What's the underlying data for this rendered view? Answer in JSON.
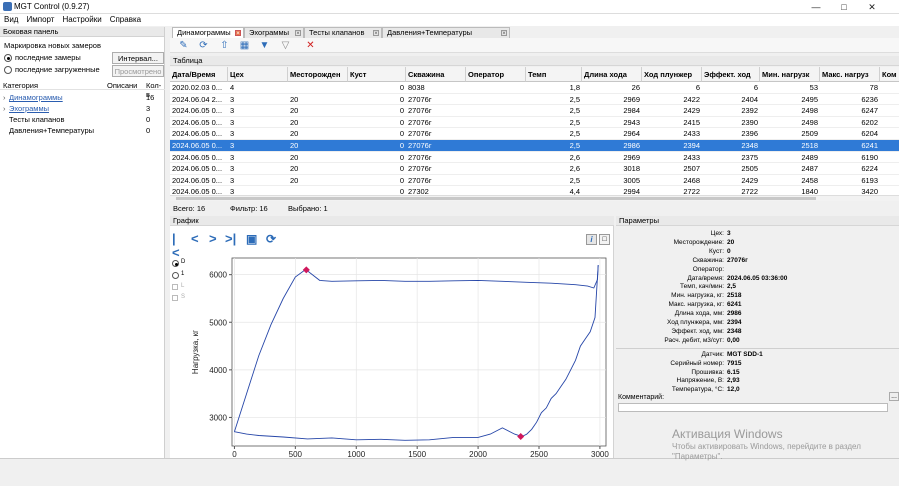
{
  "window": {
    "title": "MGT Control (0.9.27)"
  },
  "menu": [
    "Вид",
    "Импорт",
    "Настройки",
    "Справка"
  ],
  "sidebar": {
    "title": "Боковая панель",
    "marking_label": "Маркировка новых замеров",
    "radio_last_measurements": "последние замеры",
    "radio_last_loaded": "последние загруженные",
    "interval_button": "Интервал...",
    "viewed_button": "Просмотрено",
    "col_category": "Категория",
    "col_description": "Описани",
    "col_count": "Кол-в",
    "categories": [
      {
        "name": "Динамограммы",
        "count": "16",
        "link": true
      },
      {
        "name": "Эхограммы",
        "count": "3",
        "link": true
      },
      {
        "name": "Тесты клапанов",
        "count": "0",
        "link": false
      },
      {
        "name": "Давления+Температуры",
        "count": "0",
        "link": false
      }
    ]
  },
  "tabs": [
    {
      "label": "Динамограммы",
      "active": true
    },
    {
      "label": "Эхограммы",
      "active": false
    },
    {
      "label": "Тесты клапанов",
      "active": false
    },
    {
      "label": "Давления+Температуры",
      "active": false
    }
  ],
  "toolbar": {
    "icons": [
      "edit-icon",
      "refresh-icon",
      "export-icon",
      "columns-icon",
      "filter-icon",
      "filter-clear-icon",
      "delete-icon"
    ]
  },
  "table": {
    "title": "Таблица",
    "columns": [
      "Дата/Время",
      "Цех",
      "Месторожден",
      "Куст",
      "Скважина",
      "Оператор",
      "Темп",
      "Длина хода",
      "Ход плунжер",
      "Эффект. ход",
      "Мин. нагрузк",
      "Макс. нагруз",
      "Ком"
    ],
    "rows": [
      [
        "2020.02.03 0...",
        "4",
        "",
        "0",
        "8038",
        "",
        "1,8",
        "26",
        "6",
        "6",
        "53",
        "78",
        ""
      ],
      [
        "2024.06.04 2...",
        "3",
        "20",
        "0",
        "27076г",
        "",
        "2,5",
        "2969",
        "2422",
        "2404",
        "2495",
        "6236",
        ""
      ],
      [
        "2024.06.05 0...",
        "3",
        "20",
        "0",
        "27076г",
        "",
        "2,5",
        "2984",
        "2429",
        "2392",
        "2498",
        "6247",
        ""
      ],
      [
        "2024.06.05 0...",
        "3",
        "20",
        "0",
        "27076г",
        "",
        "2,5",
        "2943",
        "2415",
        "2390",
        "2498",
        "6202",
        ""
      ],
      [
        "2024.06.05 0...",
        "3",
        "20",
        "0",
        "27076г",
        "",
        "2,5",
        "2964",
        "2433",
        "2396",
        "2509",
        "6204",
        ""
      ],
      [
        "2024.06.05 0...",
        "3",
        "20",
        "0",
        "27076г",
        "",
        "2,5",
        "2986",
        "2394",
        "2348",
        "2518",
        "6241",
        ""
      ],
      [
        "2024.06.05 0...",
        "3",
        "20",
        "0",
        "27076г",
        "",
        "2,6",
        "2969",
        "2433",
        "2375",
        "2489",
        "6190",
        ""
      ],
      [
        "2024.06.05 0...",
        "3",
        "20",
        "0",
        "27076г",
        "",
        "2,6",
        "3018",
        "2507",
        "2505",
        "2487",
        "6224",
        ""
      ],
      [
        "2024.06.05 0...",
        "3",
        "20",
        "0",
        "27076г",
        "",
        "2,5",
        "3005",
        "2468",
        "2429",
        "2458",
        "6193",
        ""
      ],
      [
        "2024.06.05 0...",
        "3",
        "",
        "0",
        "27302",
        "",
        "4,4",
        "2994",
        "2722",
        "2722",
        "1840",
        "3420",
        ""
      ]
    ],
    "selected_index": 5
  },
  "status": {
    "total": "Всего: 16",
    "filter": "Фильтр: 16",
    "selected": "Выбрано: 1"
  },
  "graph": {
    "title": "График",
    "legend_items": [
      "D",
      "1",
      "L",
      "S"
    ]
  },
  "chart_data": {
    "type": "line",
    "xlabel": "Положение штока, мм",
    "ylabel": "Нагрузка, кг",
    "xlim": [
      -20,
      3050
    ],
    "ylim": [
      2400,
      6350
    ],
    "xticks": [
      0,
      500,
      1000,
      1500,
      2000,
      2500,
      3000
    ],
    "yticks": [
      3000,
      4000,
      5000,
      6000
    ],
    "grid": true,
    "series": [
      {
        "x": [
          0,
          100,
          200,
          300,
          400,
          500,
          580,
          600,
          700,
          800,
          1000,
          1200,
          1400,
          1600,
          1800,
          2000,
          2200,
          2400,
          2600,
          2800,
          2900,
          2950,
          2980,
          2986
        ],
        "y": [
          2700,
          3500,
          4300,
          4950,
          5500,
          5950,
          6100,
          6080,
          5880,
          5860,
          5870,
          5880,
          5860,
          5860,
          5870,
          5880,
          5860,
          5840,
          5820,
          5790,
          5760,
          5720,
          5900,
          6200
        ]
      },
      {
        "x": [
          2986,
          2960,
          2920,
          2880,
          2840,
          2800,
          2760,
          2720,
          2680,
          2640,
          2600,
          2560,
          2520,
          2480,
          2440,
          2400,
          2360,
          2300,
          2200,
          2100,
          2000,
          1800,
          1600,
          1400,
          1200,
          1000,
          800,
          600,
          400,
          200,
          100,
          0
        ],
        "y": [
          6200,
          5100,
          4800,
          4650,
          4500,
          4200,
          4000,
          3800,
          3650,
          3500,
          3400,
          3200,
          3100,
          2900,
          2750,
          2650,
          2600,
          2650,
          2780,
          2650,
          2580,
          2580,
          2530,
          2520,
          2540,
          2530,
          2570,
          2550,
          2590,
          2620,
          2650,
          2700
        ]
      }
    ],
    "markers": [
      {
        "x": 590,
        "y": 6100
      },
      {
        "x": 2350,
        "y": 2600
      }
    ],
    "colors": {
      "line": "#2646a8",
      "marker": "#d0185c",
      "grid": "#e5e5e5"
    }
  },
  "params": {
    "title": "Параметры",
    "items": [
      {
        "k": "Цех:",
        "v": "3"
      },
      {
        "k": "Месторождение:",
        "v": "20"
      },
      {
        "k": "Куст:",
        "v": "0"
      },
      {
        "k": "Скважина:",
        "v": "27076г"
      },
      {
        "k": "Оператор:",
        "v": ""
      },
      {
        "k": "Дата/время:",
        "v": "2024.06.05 03:36:00"
      },
      {
        "k": "Темп, кач/мин:",
        "v": "2,5"
      },
      {
        "k": "Мин. нагрузка, кг:",
        "v": "2518"
      },
      {
        "k": "Макс. нагрузка, кг:",
        "v": "6241"
      },
      {
        "k": "Длина хода, мм:",
        "v": "2986"
      },
      {
        "k": "Ход плунжера, мм:",
        "v": "2394"
      },
      {
        "k": "Эффект. ход, мм:",
        "v": "2348"
      },
      {
        "k": "Расч. дебит, м3/сут:",
        "v": "0,00"
      }
    ],
    "device_items": [
      {
        "k": "Датчик:",
        "v": "MGT SDD-1"
      },
      {
        "k": "Серийный номер:",
        "v": "7915"
      },
      {
        "k": "Прошивка:",
        "v": "6.15"
      },
      {
        "k": "Напряжение, В:",
        "v": "2,93"
      },
      {
        "k": "Температура, °С:",
        "v": "12,0"
      }
    ],
    "comment_label": "Комментарий:",
    "comment_button": "..."
  },
  "watermark": {
    "title": "Активация Windows",
    "text": "Чтобы активировать Windows, перейдите в раздел \"Параметры\"."
  }
}
